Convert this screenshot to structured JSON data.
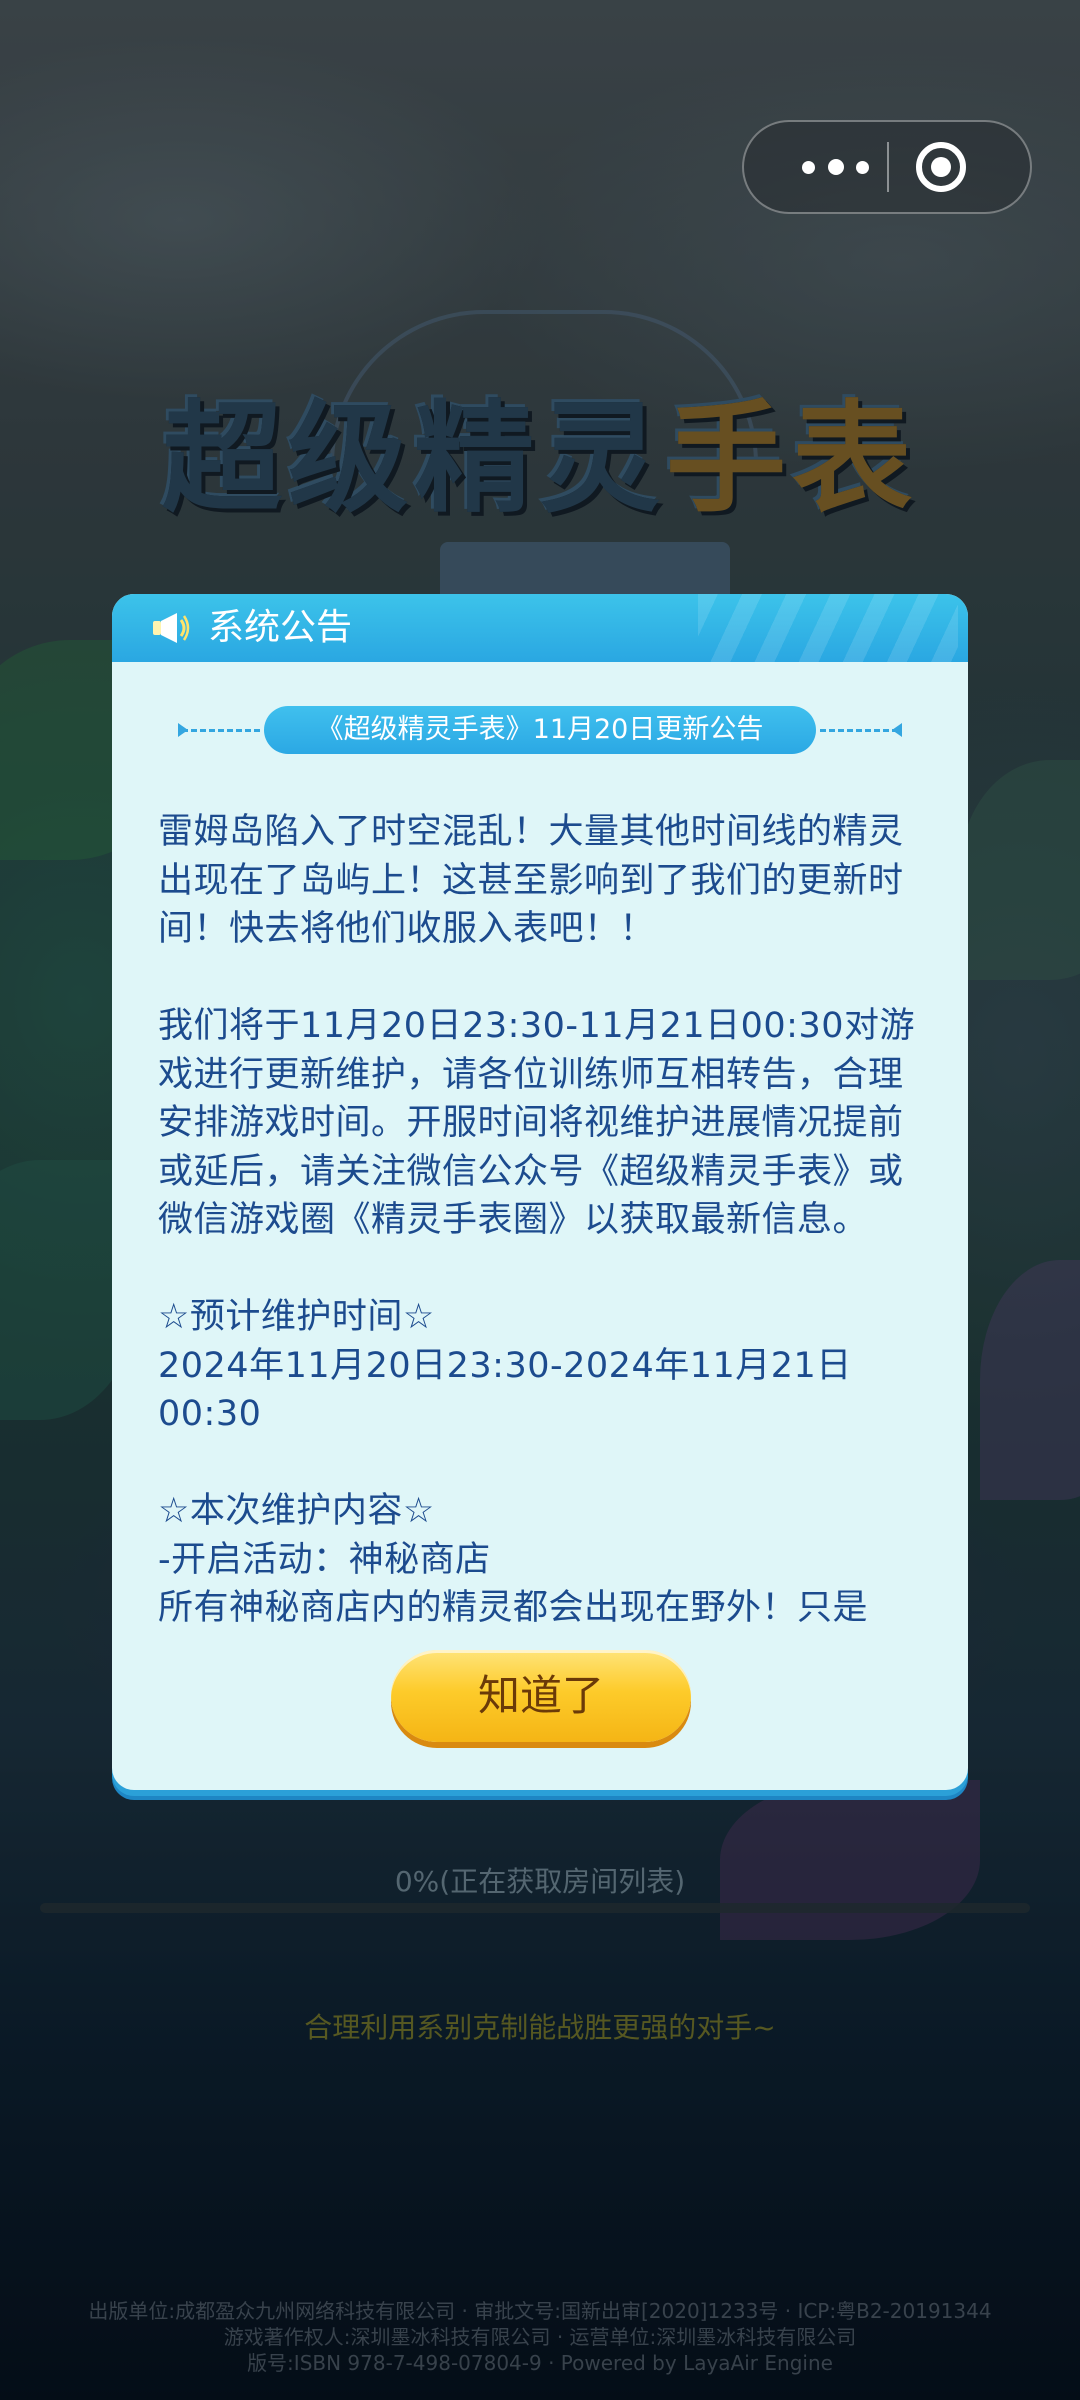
{
  "game": {
    "logo_main": "超级精灵",
    "logo_accent": "手表",
    "loading_status": "0%(正在获取房间列表)",
    "loading_progress": 0,
    "tip": "合理利用系别克制能战胜更强的对手~",
    "footer_lines": [
      "出版单位:成都盈众九州网络科技有限公司 · 审批文号:国新出审[2020]1233号 · ICP:粤B2-20191344",
      "游戏著作权人:深圳墨冰科技有限公司 · 运营单位:深圳墨冰科技有限公司",
      "版号:ISBN 978-7-498-07804-9 · Powered by LayaAir Engine"
    ]
  },
  "capsule": {
    "more_icon": "more-dots-icon",
    "close_icon": "target-close-icon"
  },
  "dialog": {
    "icon": "megaphone-icon",
    "title": "系统公告",
    "subtitle": "《超级精灵手表》11月20日更新公告",
    "paragraphs": [
      "雷姆岛陷入了时空混乱！大量其他时间线的精灵出现在了岛屿上！这甚至影响到了我们的更新时间！快去将他们收服入表吧！！",
      "我们将于11月20日23:30-11月21日00:30对游戏进行更新维护，请各位训练师互相转告，合理安排游戏时间。开服时间将视维护进展情况提前或延后，请关注微信公众号《超级精灵手表》或微信游戏圈《精灵手表圈》以获取最新信息。",
      "☆预计维护时间☆\n2024年11月20日23:30-2024年11月21日00:30",
      "☆本次维护内容☆\n-开启活动：神秘商店\n所有神秘商店内的精灵都会出现在野外！只是"
    ],
    "confirm_label": "知道了"
  },
  "colors": {
    "dialog_bg": "#dff6f8",
    "header": "#2aa7e2",
    "text": "#1c4b8e",
    "button": "#fdcb2a",
    "button_text": "#6b3a08"
  }
}
